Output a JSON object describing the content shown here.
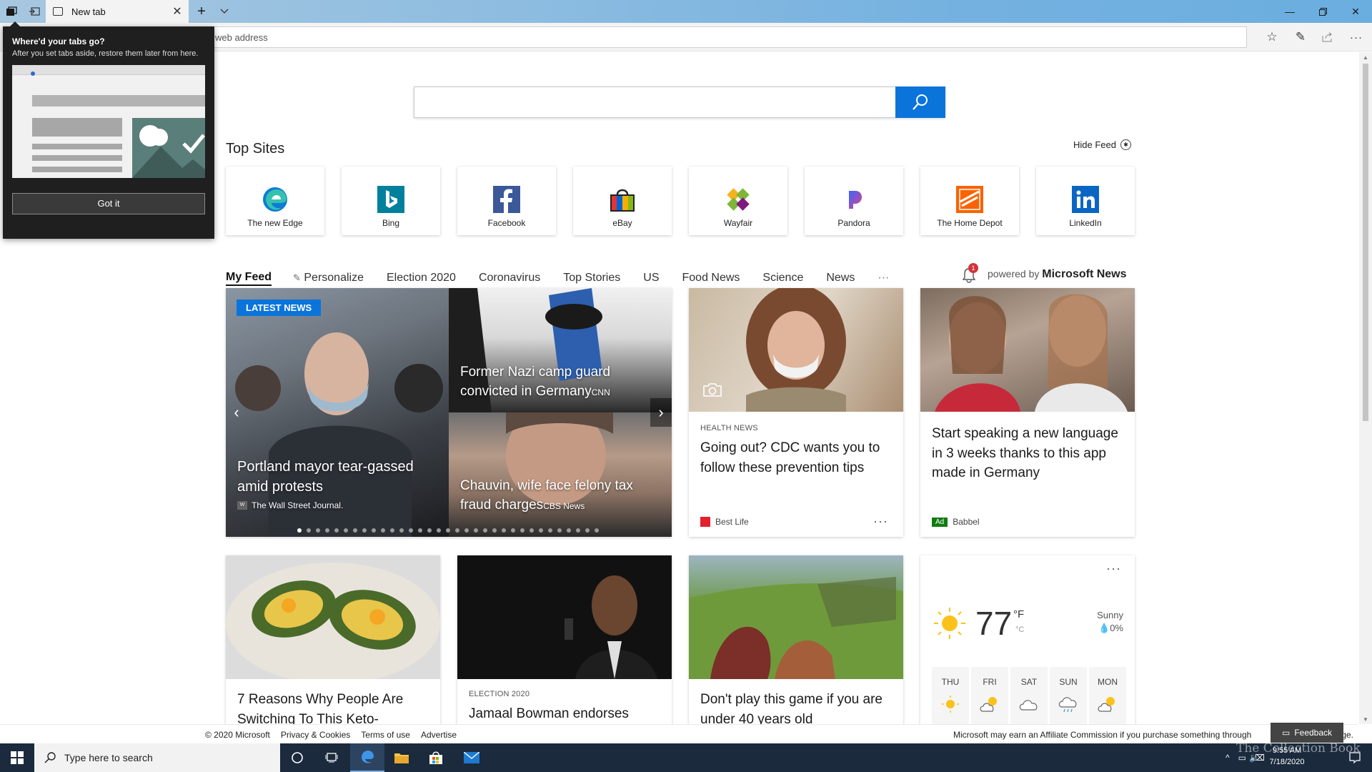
{
  "browser": {
    "tab_title": "New tab",
    "address_placeholder": "web address"
  },
  "popup": {
    "title": "Where'd your tabs go?",
    "text": "After you set tabs aside, restore them later from here.",
    "button": "Got it"
  },
  "top_sites": {
    "title": "Top Sites",
    "hide_feed": "Hide Feed",
    "items": [
      {
        "name": "The new Edge",
        "icon": "edge-icon"
      },
      {
        "name": "Bing",
        "icon": "bing-icon"
      },
      {
        "name": "Facebook",
        "icon": "facebook-icon"
      },
      {
        "name": "eBay",
        "icon": "ebay-icon"
      },
      {
        "name": "Wayfair",
        "icon": "wayfair-icon"
      },
      {
        "name": "Pandora",
        "icon": "pandora-icon"
      },
      {
        "name": "The Home Depot",
        "icon": "homedepot-icon"
      },
      {
        "name": "LinkedIn",
        "icon": "linkedin-icon"
      }
    ]
  },
  "feed_nav": {
    "items": [
      "My Feed",
      "Personalize",
      "Election 2020",
      "Coronavirus",
      "Top Stories",
      "US",
      "Food News",
      "Science",
      "News"
    ],
    "more": "···",
    "notifications": "1",
    "powered_by": "powered by",
    "provider": "Microsoft News"
  },
  "hero": {
    "badge": "LATEST NEWS",
    "main": {
      "headline": "Portland mayor tear-gassed amid protests",
      "source": "The Wall Street Journal."
    },
    "side1": {
      "headline": "Former Nazi camp guard convicted in Germany",
      "source": "CNN"
    },
    "side2": {
      "headline": "Chauvin, wife face felony tax fraud charges",
      "source": "CBS News"
    },
    "dots": 33
  },
  "cards": {
    "cdc": {
      "category": "HEALTH NEWS",
      "headline": "Going out? CDC wants you to follow these prevention tips",
      "source": "Best Life",
      "more": "···"
    },
    "babbel": {
      "headline": "Start speaking a new language in 3 weeks thanks to this app made in Germany",
      "ad": "Ad",
      "source": "Babbel"
    },
    "keto": {
      "headline": "7 Reasons Why People Are Switching To This Keto-"
    },
    "bowman": {
      "category": "ELECTION 2020",
      "headline": "Jamaal Bowman endorses"
    },
    "game": {
      "headline": "Don't play this game if you are under 40 years old"
    }
  },
  "weather": {
    "more": "···",
    "temp": "77",
    "unit_f": "°F",
    "unit_c": "°C",
    "condition": "Sunny",
    "precip": "0%",
    "forecast": [
      {
        "day": "THU",
        "icon": "sun-icon"
      },
      {
        "day": "FRI",
        "icon": "partly-cloudy-icon"
      },
      {
        "day": "SAT",
        "icon": "cloud-icon"
      },
      {
        "day": "SUN",
        "icon": "rain-cloud-icon"
      },
      {
        "day": "MON",
        "icon": "partly-cloudy-icon"
      }
    ]
  },
  "footer": {
    "links": [
      "© 2020 Microsoft",
      "Privacy & Cookies",
      "Terms of use",
      "Advertise"
    ],
    "affiliate": "Microsoft may earn an Affiliate Commission if you purchase something through",
    "affiliate_tail": "ge.",
    "feedback": "Feedback"
  },
  "taskbar": {
    "search_placeholder": "Type here to search",
    "time": "9:55 AM",
    "date": "7/18/2020",
    "watermark": "The Collection Book"
  },
  "colors": {
    "accent": "#0a74da",
    "taskbar": "#1b2a3d",
    "popup": "#1f1f1f"
  }
}
